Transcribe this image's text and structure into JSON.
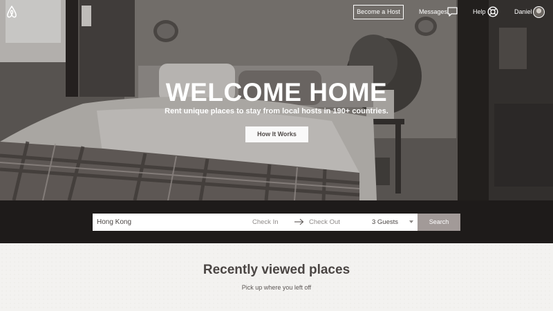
{
  "nav": {
    "become_host": "Become a Host",
    "messages": "Messages",
    "help": "Help",
    "user_name": "Daniel"
  },
  "hero": {
    "title": "WELCOME HOME",
    "subtitle": "Rent unique places to stay from local hosts in 190+ countries.",
    "how_it_works": "How It Works"
  },
  "search": {
    "location_value": "Hong Kong",
    "check_in": "Check In",
    "check_out": "Check Out",
    "guests": "3 Guests",
    "button": "Search"
  },
  "recent": {
    "title": "Recently viewed places",
    "subtitle": "Pick up where you left off"
  },
  "icons": {
    "logo": "airbnb-logo",
    "messages": "message-bubble-icon",
    "help": "lifebuoy-icon",
    "arrow": "arrow-right-icon",
    "caret": "caret-down-icon"
  },
  "colors": {
    "search_band": "#1e1b1a",
    "search_button": "#a29a98",
    "text_dark": "#4a4543"
  }
}
